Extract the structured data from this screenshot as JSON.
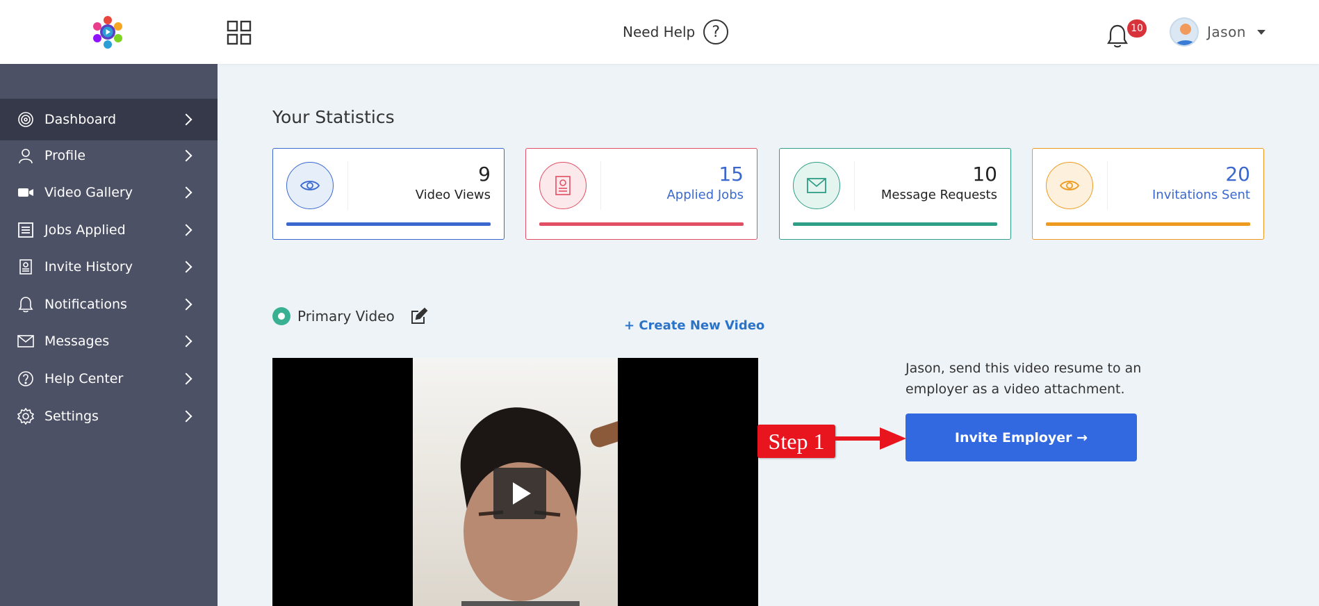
{
  "header": {
    "need_help_label": "Need Help",
    "notification_count": "10",
    "user_name": "Jason"
  },
  "sidebar": {
    "items": [
      {
        "label": "Dashboard",
        "icon": "dashboard-icon",
        "active": true
      },
      {
        "label": "Profile",
        "icon": "user-icon"
      },
      {
        "label": "Video Gallery",
        "icon": "video-camera-icon"
      },
      {
        "label": "Jobs Applied",
        "icon": "document-list-icon"
      },
      {
        "label": "Invite History",
        "icon": "invite-document-icon"
      },
      {
        "label": "Notifications",
        "icon": "bell-icon"
      },
      {
        "label": "Messages",
        "icon": "envelope-icon"
      },
      {
        "label": "Help Center",
        "icon": "help-circle-icon"
      },
      {
        "label": "Settings",
        "icon": "gear-icon"
      }
    ]
  },
  "stats": {
    "title": "Your Statistics",
    "cards": [
      {
        "value": "9",
        "label": "Video Views",
        "color": "#3a68cf",
        "icon": "eye-icon"
      },
      {
        "value": "15",
        "label": "Applied Jobs",
        "color": "#e24e63",
        "icon": "resume-icon"
      },
      {
        "value": "10",
        "label": "Message Requests",
        "color": "#2f9e86",
        "icon": "envelope-icon"
      },
      {
        "value": "20",
        "label": "Invitations Sent",
        "color": "#ee9a1f",
        "icon": "eye-icon"
      }
    ]
  },
  "video": {
    "primary_label": "Primary Video",
    "create_link": "+ Create New Video",
    "message": "Jason, send this video resume to an employer as a video attachment.",
    "invite_button": "Invite Employer →",
    "step_label": "Step 1"
  },
  "colors": {
    "sidebar": "#4d5166",
    "sidebar_active": "#353949",
    "accent_blue": "#3369e0",
    "primary_green": "#3ab093",
    "step_red": "#e8141e"
  }
}
